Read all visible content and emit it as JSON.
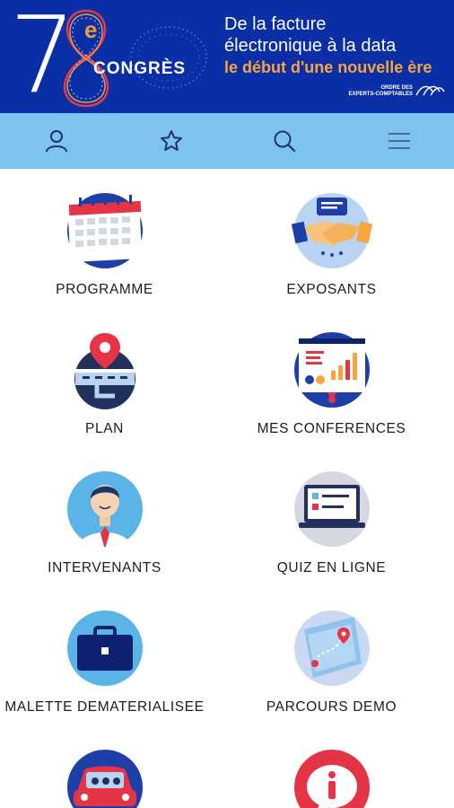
{
  "banner": {
    "edition_number": "7",
    "edition_number_second": "8",
    "edition_suffix": "e",
    "event_name": "CONGRÈS",
    "headline_line1": "De la facture",
    "headline_line2": "électronique à la data",
    "headline_line3": "le début d'une nouvelle ère",
    "org_line1": "ORDRE DES",
    "org_line2": "EXPERTS-COMPTABLES",
    "colors": {
      "background": "#0a2ea5",
      "accent": "#f7a63d",
      "text": "#ffffff"
    }
  },
  "toolbar": {
    "background": "#7cc3f2",
    "buttons": [
      {
        "name": "profile-button",
        "icon": "user-icon"
      },
      {
        "name": "favorites-button",
        "icon": "star-icon"
      },
      {
        "name": "search-button",
        "icon": "search-icon"
      },
      {
        "name": "menu-button",
        "icon": "hamburger-menu-icon"
      }
    ]
  },
  "menu": {
    "items": [
      {
        "label": "PROGRAMME",
        "icon": "calendar-icon"
      },
      {
        "label": "EXPOSANTS",
        "icon": "handshake-icon"
      },
      {
        "label": "PLAN",
        "icon": "map-pin-icon"
      },
      {
        "label": "MES CONFERENCES",
        "icon": "presentation-board-icon"
      },
      {
        "label": "INTERVENANTS",
        "icon": "speaker-person-icon"
      },
      {
        "label": "QUIZ EN LIGNE",
        "icon": "laptop-quiz-icon"
      },
      {
        "label": "MALETTE DEMATERIALISEE",
        "icon": "briefcase-icon"
      },
      {
        "label": "PARCOURS DEMO",
        "icon": "route-map-icon"
      },
      {
        "label": "",
        "icon": "car-icon"
      },
      {
        "label": "",
        "icon": "info-bubble-icon"
      }
    ]
  }
}
